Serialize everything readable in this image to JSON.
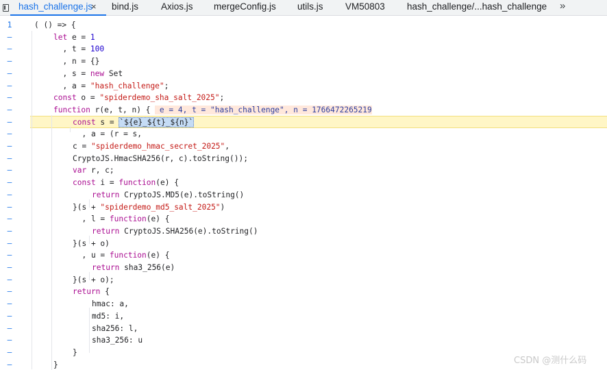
{
  "tabs": [
    {
      "label": "hash_challenge.js",
      "active": true,
      "closable": true
    },
    {
      "label": "bind.js"
    },
    {
      "label": "Axios.js"
    },
    {
      "label": "mergeConfig.js"
    },
    {
      "label": "utils.js"
    },
    {
      "label": "VM50803"
    },
    {
      "label": "hash_challenge/...hash_challenge"
    }
  ],
  "tab_close_glyph": "×",
  "more_tabs_glyph": "»",
  "watermark": "CSDN @测什么码",
  "colors": {
    "keyword": "#aa0d91",
    "string": "#c41a16",
    "number": "#1c00cf",
    "accent": "#1a73e8",
    "exec_line": "#fff6c6",
    "inline_value_bg": "#ffe8dc"
  },
  "code": [
    {
      "g": "1",
      "tokens": [
        [
          "id",
          "( () => {"
        ]
      ]
    },
    {
      "g": "–",
      "tokens": [
        [
          "kw",
          "let"
        ],
        [
          "id",
          " e = "
        ],
        [
          "num",
          "1"
        ]
      ]
    },
    {
      "g": "–",
      "tokens": [
        [
          "id",
          "  , t = "
        ],
        [
          "num",
          "100"
        ]
      ]
    },
    {
      "g": "–",
      "tokens": [
        [
          "id",
          "  , n = {}"
        ]
      ]
    },
    {
      "g": "–",
      "tokens": [
        [
          "id",
          "  , s = "
        ],
        [
          "kw",
          "new"
        ],
        [
          "id",
          " Set"
        ]
      ]
    },
    {
      "g": "–",
      "tokens": [
        [
          "id",
          "  , a = "
        ],
        [
          "str",
          "\"hash_challenge\""
        ],
        [
          "id",
          ";"
        ]
      ]
    },
    {
      "g": "–",
      "tokens": [
        [
          "kw",
          "const"
        ],
        [
          "id",
          " o = "
        ],
        [
          "str",
          "\"spiderdemo_sha_salt_2025\""
        ],
        [
          "id",
          ";"
        ]
      ]
    },
    {
      "g": "–",
      "tokens": [
        [
          "kw",
          "function"
        ],
        [
          "id",
          " r(e, t, n) { "
        ],
        [
          "val",
          " e = 4, t = \"hash_challenge\", n = 1766472265219"
        ]
      ]
    },
    {
      "g": "–",
      "exec": true,
      "tokens": [
        [
          "kw",
          "const"
        ],
        [
          "id",
          " s = "
        ],
        [
          "sel",
          "`${e}_${t}_${n}`"
        ]
      ]
    },
    {
      "g": "–",
      "tokens": [
        [
          "id",
          "  , a = (r = s,"
        ]
      ]
    },
    {
      "g": "–",
      "tokens": [
        [
          "id",
          "c = "
        ],
        [
          "str",
          "\"spiderdemo_hmac_secret_2025\""
        ],
        [
          "id",
          ","
        ]
      ]
    },
    {
      "g": "–",
      "tokens": [
        [
          "id",
          "CryptoJS.HmacSHA256(r, c).toString());"
        ]
      ]
    },
    {
      "g": "–",
      "tokens": [
        [
          "kw",
          "var"
        ],
        [
          "id",
          " r, c;"
        ]
      ]
    },
    {
      "g": "–",
      "tokens": [
        [
          "kw",
          "const"
        ],
        [
          "id",
          " i = "
        ],
        [
          "kw",
          "function"
        ],
        [
          "id",
          "(e) {"
        ]
      ]
    },
    {
      "g": "–",
      "tokens": [
        [
          "kw",
          "return"
        ],
        [
          "id",
          " CryptoJS.MD5(e).toString()"
        ]
      ]
    },
    {
      "g": "–",
      "tokens": [
        [
          "id",
          "}(s + "
        ],
        [
          "str",
          "\"spiderdemo_md5_salt_2025\""
        ],
        [
          "id",
          ")"
        ]
      ]
    },
    {
      "g": "–",
      "tokens": [
        [
          "id",
          "  , l = "
        ],
        [
          "kw",
          "function"
        ],
        [
          "id",
          "(e) {"
        ]
      ]
    },
    {
      "g": "–",
      "tokens": [
        [
          "kw",
          "return"
        ],
        [
          "id",
          " CryptoJS.SHA256(e).toString()"
        ]
      ]
    },
    {
      "g": "–",
      "tokens": [
        [
          "id",
          "}(s + o)"
        ]
      ]
    },
    {
      "g": "–",
      "tokens": [
        [
          "id",
          "  , u = "
        ],
        [
          "kw",
          "function"
        ],
        [
          "id",
          "(e) {"
        ]
      ]
    },
    {
      "g": "–",
      "tokens": [
        [
          "kw",
          "return"
        ],
        [
          "id",
          " sha3_256(e)"
        ]
      ]
    },
    {
      "g": "–",
      "tokens": [
        [
          "id",
          "}(s + o);"
        ]
      ]
    },
    {
      "g": "–",
      "tokens": [
        [
          "kw",
          "return"
        ],
        [
          "id",
          " {"
        ]
      ]
    },
    {
      "g": "–",
      "tokens": [
        [
          "id",
          "hmac: a,"
        ]
      ]
    },
    {
      "g": "–",
      "tokens": [
        [
          "id",
          "md5: i,"
        ]
      ]
    },
    {
      "g": "–",
      "tokens": [
        [
          "id",
          "sha256: l,"
        ]
      ]
    },
    {
      "g": "–",
      "tokens": [
        [
          "id",
          "sha3_256: u"
        ]
      ]
    },
    {
      "g": "–",
      "tokens": [
        [
          "id",
          "}"
        ]
      ]
    },
    {
      "g": "–",
      "tokens": [
        [
          "id",
          "}"
        ]
      ]
    }
  ]
}
